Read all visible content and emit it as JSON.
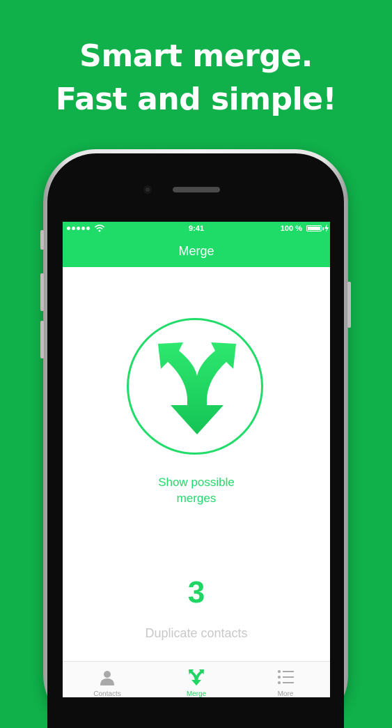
{
  "headline": {
    "line1": "Smart merge.",
    "line2": "Fast and simple!"
  },
  "status_bar": {
    "time": "9:41",
    "battery": "100 %",
    "icons": [
      "signal-dots-icon",
      "wifi-icon",
      "battery-icon",
      "charging-bolt-icon"
    ]
  },
  "nav": {
    "title": "Merge"
  },
  "main": {
    "merge_icon": "merge-arrow-icon",
    "show_merges_line1": "Show possible",
    "show_merges_line2": "merges",
    "duplicate_count": "3",
    "duplicate_label": "Duplicate contacts"
  },
  "tabs": [
    {
      "label": "Contacts",
      "icon": "person-icon",
      "active": false
    },
    {
      "label": "Merge",
      "icon": "merge-icon",
      "active": true
    },
    {
      "label": "More",
      "icon": "list-icon",
      "active": false
    }
  ],
  "colors": {
    "background": "#10b04a",
    "accent": "#1fdb67",
    "text_muted": "#c8c8c8",
    "tab_inactive": "#9b9b9b"
  }
}
